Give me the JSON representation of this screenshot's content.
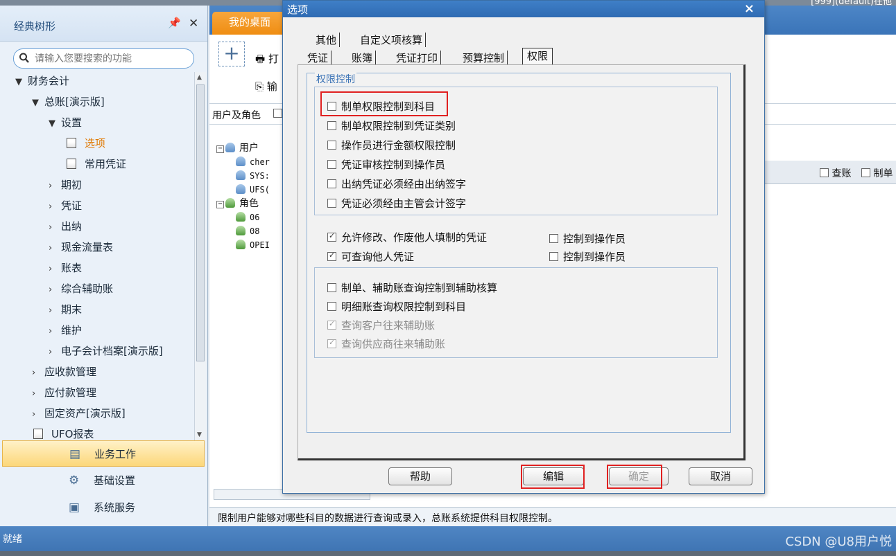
{
  "top_right_text": "[999](default)在他",
  "left_panel": {
    "title": "经典树形",
    "search_placeholder": "请输入您要搜索的功能",
    "tree": [
      {
        "label": "财务会计",
        "arrow": "▼"
      },
      {
        "label": "总账[演示版]",
        "arrow": "▼"
      },
      {
        "label": "设置",
        "arrow": "▼"
      },
      {
        "label": "选项",
        "arrow": ""
      },
      {
        "label": "常用凭证",
        "arrow": ""
      },
      {
        "label": "期初",
        "arrow": "›"
      },
      {
        "label": "凭证",
        "arrow": "›"
      },
      {
        "label": "出纳",
        "arrow": "›"
      },
      {
        "label": "现金流量表",
        "arrow": "›"
      },
      {
        "label": "账表",
        "arrow": "›"
      },
      {
        "label": "综合辅助账",
        "arrow": "›"
      },
      {
        "label": "期末",
        "arrow": "›"
      },
      {
        "label": "维护",
        "arrow": "›"
      },
      {
        "label": "电子会计档案[演示版]",
        "arrow": "›"
      },
      {
        "label": "应收款管理",
        "arrow": "›"
      },
      {
        "label": "应付款管理",
        "arrow": "›"
      },
      {
        "label": "固定资产[演示版]",
        "arrow": "›"
      },
      {
        "label": "UFO报表",
        "arrow": ""
      }
    ],
    "nav_buttons": [
      "业务工作",
      "基础设置",
      "系统服务"
    ]
  },
  "content": {
    "tab_desktop": "我的桌面",
    "print_label": "打",
    "output_label": "输",
    "user_role_label": "用户及角色",
    "user_tree": {
      "users_label": "用户",
      "users": [
        "cher",
        "SYS:",
        "UFS("
      ],
      "roles_label": "角色",
      "roles": [
        "06",
        "08",
        "OPEI"
      ]
    },
    "col_query": "查账",
    "col_make": "制单",
    "hint": "限制用户能够对哪些科目的数据进行查询或录入，总账系统提供科目权限控制。"
  },
  "status": {
    "text": "就绪",
    "watermark": "CSDN @U8用户悦"
  },
  "dialog": {
    "title": "选项",
    "close": "×",
    "tabs_row1": [
      "其他",
      "自定义项核算"
    ],
    "tabs_row2": [
      "凭证",
      "账簿",
      "凭证打印",
      "预算控制",
      "权限"
    ],
    "active_tab": "权限",
    "frame_legend": "权限控制",
    "group1": [
      {
        "label": "制单权限控制到科目",
        "checked": false
      },
      {
        "label": "制单权限控制到凭证类别",
        "checked": false
      },
      {
        "label": "操作员进行金额权限控制",
        "checked": false
      },
      {
        "label": "凭证审核控制到操作员",
        "checked": false
      },
      {
        "label": "出纳凭证必须经由出纳签字",
        "checked": false
      },
      {
        "label": "凭证必须经由主管会计签字",
        "checked": false
      }
    ],
    "mid_options": [
      {
        "label": "允许修改、作废他人填制的凭证",
        "checked": true
      },
      {
        "label": "控制到操作员",
        "checked": false
      },
      {
        "label": "可查询他人凭证",
        "checked": true
      },
      {
        "label": "控制到操作员",
        "checked": false
      }
    ],
    "group2": [
      {
        "label": "制单、辅助账查询控制到辅助核算",
        "checked": false,
        "disabled": false
      },
      {
        "label": "明细账查询权限控制到科目",
        "checked": false,
        "disabled": false
      },
      {
        "label": "查询客户往来辅助账",
        "checked": true,
        "disabled": true
      },
      {
        "label": "查询供应商往来辅助账",
        "checked": true,
        "disabled": true
      }
    ],
    "buttons": {
      "help": "帮助",
      "edit": "编辑",
      "ok": "确定",
      "cancel": "取消"
    }
  },
  "colors": {
    "accent_orange": "#ef8d12",
    "title_blue": "#2f6bb3",
    "highlight_red": "#e02020"
  }
}
